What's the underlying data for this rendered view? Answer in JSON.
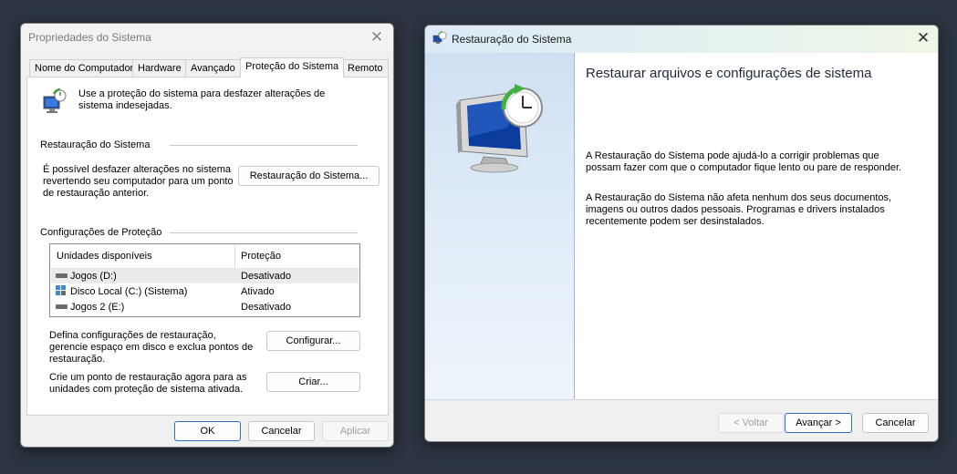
{
  "props": {
    "title": "Propriedades do Sistema",
    "tabs": [
      "Nome do Computador",
      "Hardware",
      "Avançado",
      "Proteção do Sistema",
      "Remoto"
    ],
    "active_tab": "Proteção do Sistema",
    "intro": "Use a proteção do sistema para desfazer alterações de sistema indesejadas.",
    "restore_group": "Restauração do Sistema",
    "restore_desc": "É possível desfazer alterações no sistema revertendo seu computador para um ponto de restauração anterior.",
    "restore_button": "Restauração do Sistema...",
    "protect_group": "Configurações de Proteção",
    "table_headers": [
      "Unidades disponíveis",
      "Proteção"
    ],
    "drives": [
      {
        "name": "Jogos (D:)",
        "status": "Desativado",
        "icon": "drive-icon"
      },
      {
        "name": "Disco Local (C:) (Sistema)",
        "status": "Ativado",
        "icon": "windows-drive-icon"
      },
      {
        "name": "Jogos 2 (E:)",
        "status": "Desativado",
        "icon": "drive-icon"
      }
    ],
    "config_desc": "Defina configurações de restauração, gerencie espaço em disco e exclua pontos de restauração.",
    "config_button": "Configurar...",
    "create_desc": "Crie um ponto de restauração agora para as unidades com proteção de sistema ativada.",
    "create_button": "Criar...",
    "ok": "OK",
    "cancel": "Cancelar",
    "apply": "Aplicar"
  },
  "restore": {
    "title": "Restauração do Sistema",
    "heading": "Restaurar arquivos e configurações de sistema",
    "para1": "A Restauração do Sistema pode ajudá-lo a corrigir problemas que possam fazer com que o computador fique lento ou pare de responder.",
    "para2": "A Restauração do Sistema não afeta nenhum dos seus documentos, imagens ou outros dados pessoais. Programas e drivers instalados recentemente podem ser desinstalados.",
    "back": "< Voltar",
    "next": "Avançar >",
    "cancel": "Cancelar"
  },
  "colors": {
    "background": "#2b3440",
    "accent": "#2d6ec9",
    "panel_blue": "#dbe8f6"
  }
}
